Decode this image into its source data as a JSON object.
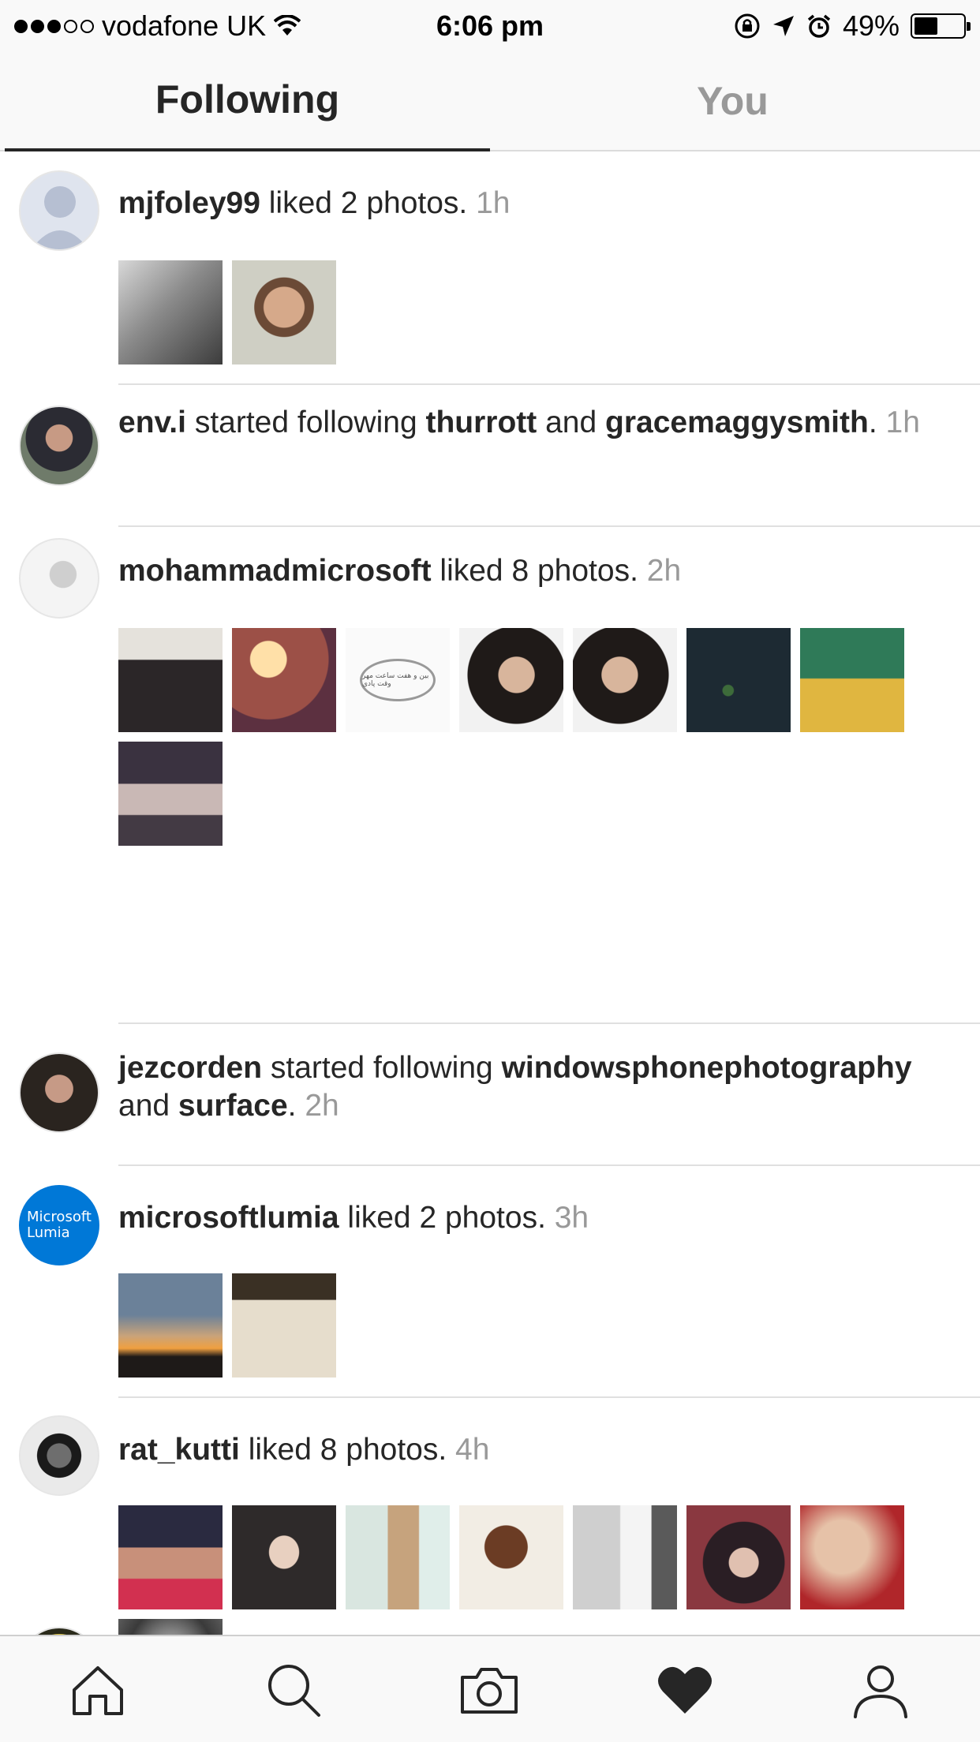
{
  "status_bar": {
    "carrier": "vodafone UK",
    "time": "6:06 pm",
    "battery": "49%",
    "battery_level": 0.49,
    "icons": [
      "signal-dots",
      "wifi-icon",
      "rotation-lock-icon",
      "location-arrow-icon",
      "alarm-icon",
      "battery-icon"
    ]
  },
  "tabs": [
    {
      "label": "Following",
      "active": true
    },
    {
      "label": "You",
      "active": false
    }
  ],
  "feed": [
    {
      "user": "mjfoley99",
      "text": " liked 2 photos. ",
      "time": "1h",
      "photo_count": 2
    },
    {
      "user": "env.i",
      "text1": " started following ",
      "target1": "thurrott",
      "text2": " and ",
      "target2": "gracemaggysmith",
      "text3": ". ",
      "time": "1h"
    },
    {
      "user": "mohammadmicrosoft",
      "text": " liked 8 photos. ",
      "time": "2h",
      "photo_count": 8,
      "photo_caption": "بین و هفت ساعت مهر وقت پادی"
    },
    {
      "user": "jezcorden",
      "text1": " started following ",
      "target1": "windowsphonephotography",
      "text2": " and ",
      "target2": "surface",
      "text3": ". ",
      "time": "2h"
    },
    {
      "user": "microsoftlumia",
      "avatar_text": "Microsoft Lumia",
      "text": " liked 2 photos. ",
      "time": "3h",
      "photo_count": 2
    },
    {
      "user": "rat_kutti",
      "text": " liked 8 photos. ",
      "time": "4h",
      "photo_count": 8
    }
  ],
  "bottom_nav": [
    {
      "icon": "home-icon"
    },
    {
      "icon": "search-icon"
    },
    {
      "icon": "camera-icon"
    },
    {
      "icon": "heart-icon",
      "active": true
    },
    {
      "icon": "profile-icon"
    }
  ],
  "colors": {
    "text": "#262626",
    "muted": "#999999",
    "bar_bg": "#f9f9f9",
    "lumia_blue": "#0078d7"
  }
}
